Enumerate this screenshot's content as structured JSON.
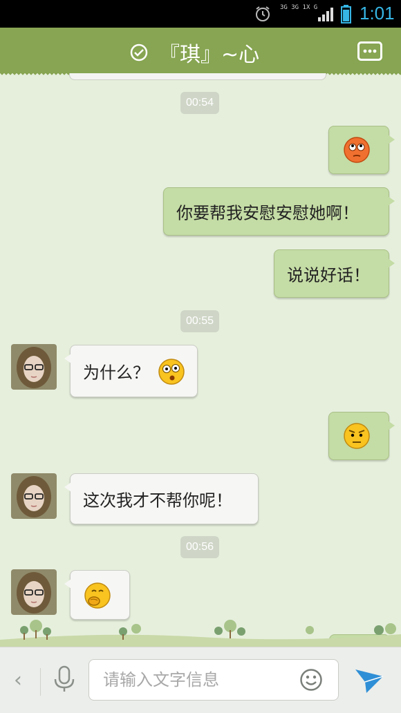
{
  "status_bar": {
    "time": "1:01",
    "network_labels": [
      "3G",
      "3G",
      "1X",
      "G"
    ],
    "time_color": "#36b6e5"
  },
  "header": {
    "title": "『琪』~心",
    "bg_color": "#87a552"
  },
  "messages": [
    {
      "type": "timestamp",
      "text": "00:54"
    },
    {
      "type": "emoji",
      "side": "out",
      "icon": "rolling-eyes-emoji"
    },
    {
      "type": "text",
      "side": "out",
      "text": "你要帮我安慰安慰她啊！"
    },
    {
      "type": "text",
      "side": "out",
      "text": "说说好话！"
    },
    {
      "type": "timestamp",
      "text": "00:55"
    },
    {
      "type": "text",
      "side": "in",
      "text": "为什么？",
      "icon": "confused-emoji"
    },
    {
      "type": "emoji",
      "side": "out",
      "icon": "annoyed-emoji"
    },
    {
      "type": "text",
      "side": "in",
      "text": "这次我才不帮你呢！"
    },
    {
      "type": "timestamp",
      "text": "00:56"
    },
    {
      "type": "emoji",
      "side": "in",
      "icon": "giggle-emoji"
    }
  ],
  "input_bar": {
    "back_glyph": "‹",
    "placeholder": "请输入文字信息"
  }
}
